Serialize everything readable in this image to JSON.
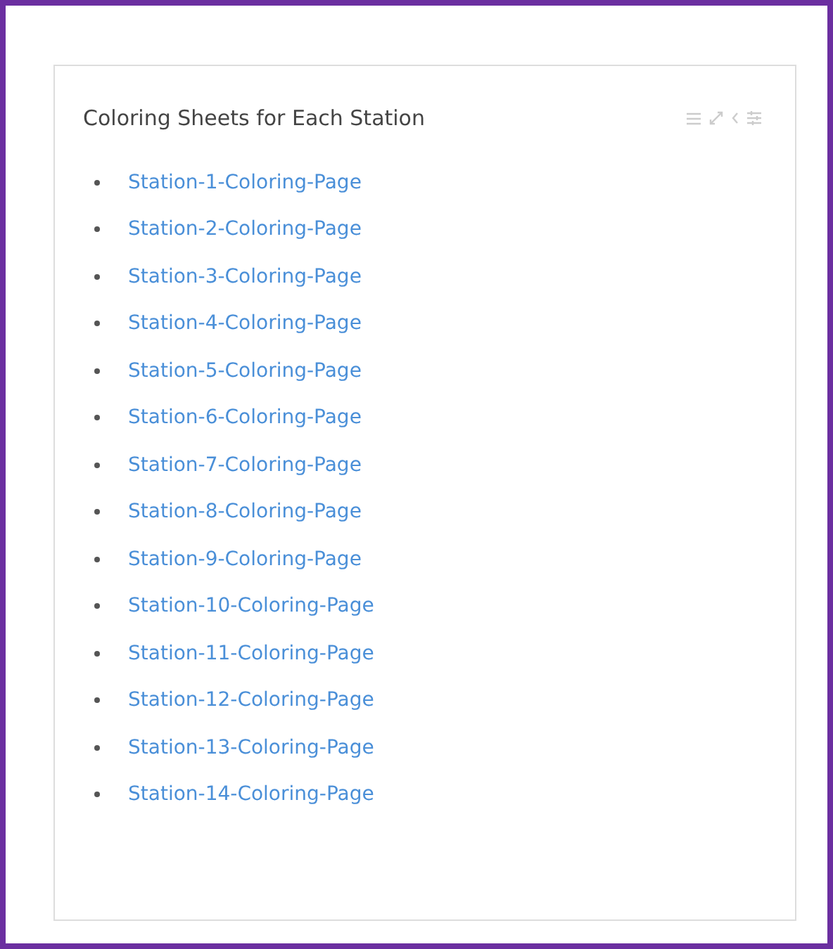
{
  "panel": {
    "title": "Coloring Sheets for Each Station",
    "links": [
      "Station-1-Coloring-Page",
      "Station-2-Coloring-Page",
      "Station-3-Coloring-Page",
      "Station-4-Coloring-Page",
      "Station-5-Coloring-Page",
      "Station-6-Coloring-Page",
      "Station-7-Coloring-Page",
      "Station-8-Coloring-Page",
      "Station-9-Coloring-Page",
      "Station-10-Coloring-Page",
      "Station-11-Coloring-Page",
      "Station-12-Coloring-Page",
      "Station-13-Coloring-Page",
      "Station-14-Coloring-Page"
    ]
  }
}
